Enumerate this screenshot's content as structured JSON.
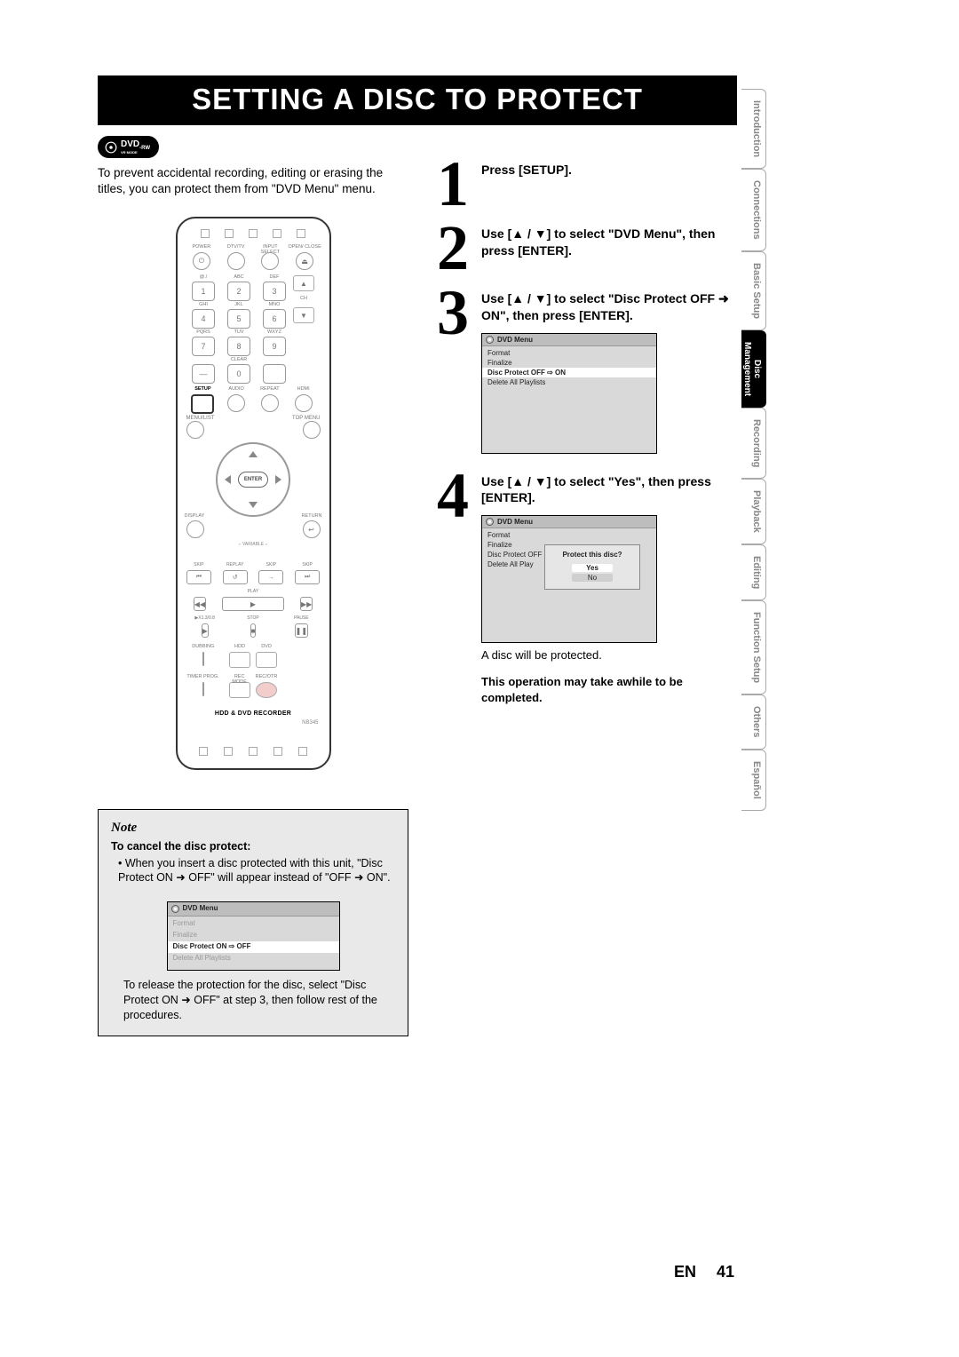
{
  "title": "SETTING A DISC TO PROTECT",
  "badge": {
    "text": "DVD",
    "sub": "-RW",
    "mode": "VR MODE"
  },
  "intro": "To prevent accidental recording, editing or erasing the titles, you can protect them from \"DVD Menu\" menu.",
  "remote": {
    "top_labels": [
      "POWER",
      "DTV/TV",
      "INPUT SELECT",
      "OPEN/ CLOSE"
    ],
    "keypad_labels": [
      "@./",
      "ABC",
      "DEF",
      "GHI",
      "JKL",
      "MNO",
      "PQRS",
      "TUV",
      "WXYZ",
      "",
      "",
      "CLEAR"
    ],
    "keypad_nums": [
      "1",
      "2",
      "3",
      "4",
      "5",
      "6",
      "7",
      "8",
      "9",
      "—",
      "0",
      ""
    ],
    "ch": "CH",
    "row_setup": [
      "SETUP",
      "AUDIO",
      "REPEAT",
      "HDMI"
    ],
    "menu_list": "MENU/LIST",
    "top_menu": "TOP MENU",
    "enter": "ENTER",
    "display": "DISPLAY",
    "return": "RETURN",
    "variable": "VARIABLE",
    "transport_labels": [
      "SKIP",
      "REPLAY",
      "SKIP",
      "SKIP"
    ],
    "transport_icons": [
      "⏮",
      "↺",
      "→",
      "⏭"
    ],
    "play_label": "PLAY",
    "rew": "◀◀",
    "play": "▶",
    "ff": "▶▶",
    "bottom_labels": [
      "▶X1.3/0.8",
      "STOP",
      "PAUSE"
    ],
    "bottom_icons": [
      "",
      "■",
      "❚❚"
    ],
    "dubbing": "DUBBING",
    "hdd": "HDD",
    "dvd": "DVD",
    "timer": "TIMER PROG.",
    "recmode": "REC MODE",
    "recotr": "REC/OTR",
    "product": "HDD & DVD RECORDER",
    "model": "NB345"
  },
  "steps": [
    {
      "n": "1",
      "head": "Press [SETUP]."
    },
    {
      "n": "2",
      "head": "Use [▲ / ▼] to select \"DVD Menu\", then press [ENTER]."
    },
    {
      "n": "3",
      "head": "Use [▲ / ▼] to select \"Disc Protect OFF ➜ ON\", then press [ENTER]."
    },
    {
      "n": "4",
      "head": "Use [▲ / ▼] to select \"Yes\", then press [ENTER]."
    }
  ],
  "osd3": {
    "title": "DVD Menu",
    "lines": [
      "Format",
      "Finalize"
    ],
    "highlight": "Disc Protect OFF ⇨ ON",
    "after": [
      "Delete All Playlists"
    ]
  },
  "osd4": {
    "title": "DVD Menu",
    "lines": [
      "Format",
      "Finalize",
      "Disc Protect OFF",
      "Delete All Play"
    ],
    "dialog": {
      "q": "Protect this disc?",
      "yes": "Yes",
      "no": "No"
    }
  },
  "step4_note": "A disc will be protected.",
  "step4_bold": "This operation may take awhile to be completed.",
  "note": {
    "title": "Note",
    "sub": "To cancel the disc protect:",
    "li1": "When you insert a disc protected with this unit, \"Disc Protect ON ➜ OFF\" will appear instead of \"OFF ➜ ON\".",
    "osd": {
      "title": "DVD Menu",
      "lines": [
        "Format",
        "Finalize"
      ],
      "highlight": "Disc Protect ON ⇨ OFF",
      "after": [
        "Delete All Playlists"
      ]
    },
    "closing": "To release the protection for the disc, select \"Disc Protect ON ➜ OFF\" at step 3, then follow rest of the procedures."
  },
  "tabs": [
    "Introduction",
    "Connections",
    "Basic Setup",
    "Disc Management",
    "Recording",
    "Playback",
    "Editing",
    "Function Setup",
    "Others",
    "Español"
  ],
  "active_tab_index": 3,
  "footer": {
    "lang": "EN",
    "page": "41"
  }
}
